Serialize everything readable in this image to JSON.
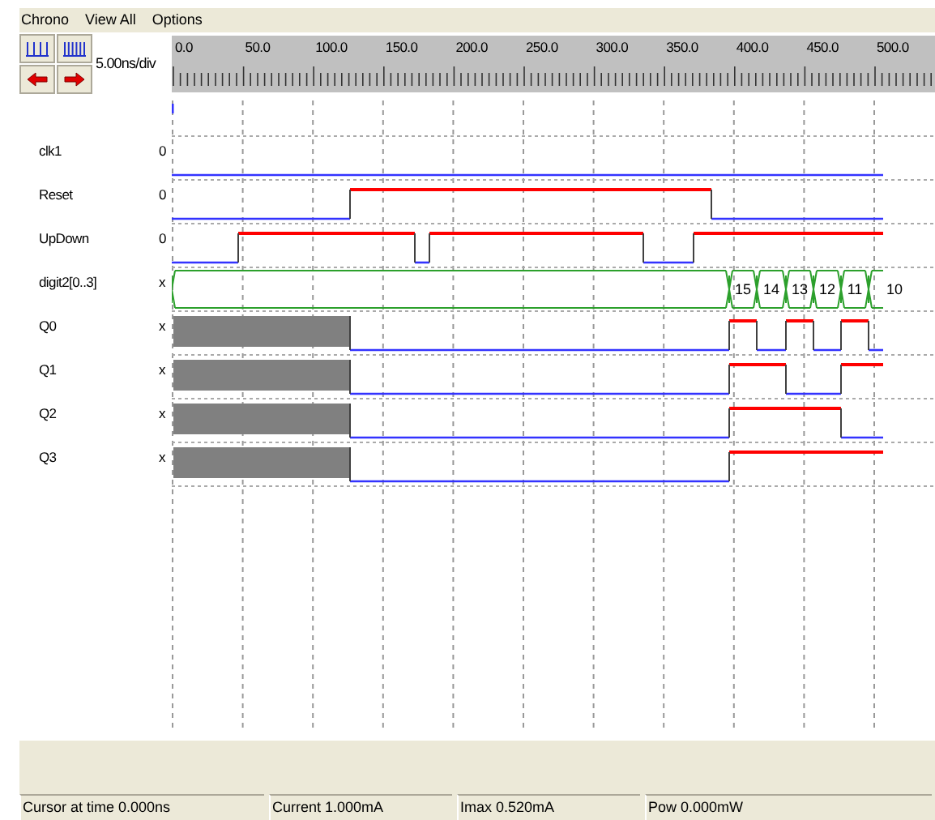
{
  "menu": [
    "Chrono",
    "View All",
    "Options"
  ],
  "toolbar": {
    "scale": "5.00ns/div"
  },
  "ruler_labels": [
    "0.0",
    "50.0",
    "100.0",
    "150.0",
    "200.0",
    "250.0",
    "300.0",
    "350.0",
    "400.0",
    "450.0",
    "500.0"
  ],
  "signals": [
    {
      "name": "clk1",
      "value": "0",
      "kind": "bit"
    },
    {
      "name": "Reset",
      "value": "0",
      "kind": "bit"
    },
    {
      "name": "UpDown",
      "value": "0",
      "kind": "bit"
    },
    {
      "name": "digit2[0..3]",
      "value": "x",
      "kind": "bus",
      "bus_values": [
        "15",
        "14",
        "13",
        "12",
        "11",
        "10"
      ]
    },
    {
      "name": "Q0",
      "value": "x",
      "kind": "bit"
    },
    {
      "name": "Q1",
      "value": "x",
      "kind": "bit"
    },
    {
      "name": "Q2",
      "value": "x",
      "kind": "bit"
    },
    {
      "name": "Q3",
      "value": "x",
      "kind": "bit"
    }
  ],
  "status_bar": [
    "Cursor at time 0.000ns",
    "Current 1.000mA",
    "Imax 0.520mA",
    "Pow 0.000mW"
  ]
}
